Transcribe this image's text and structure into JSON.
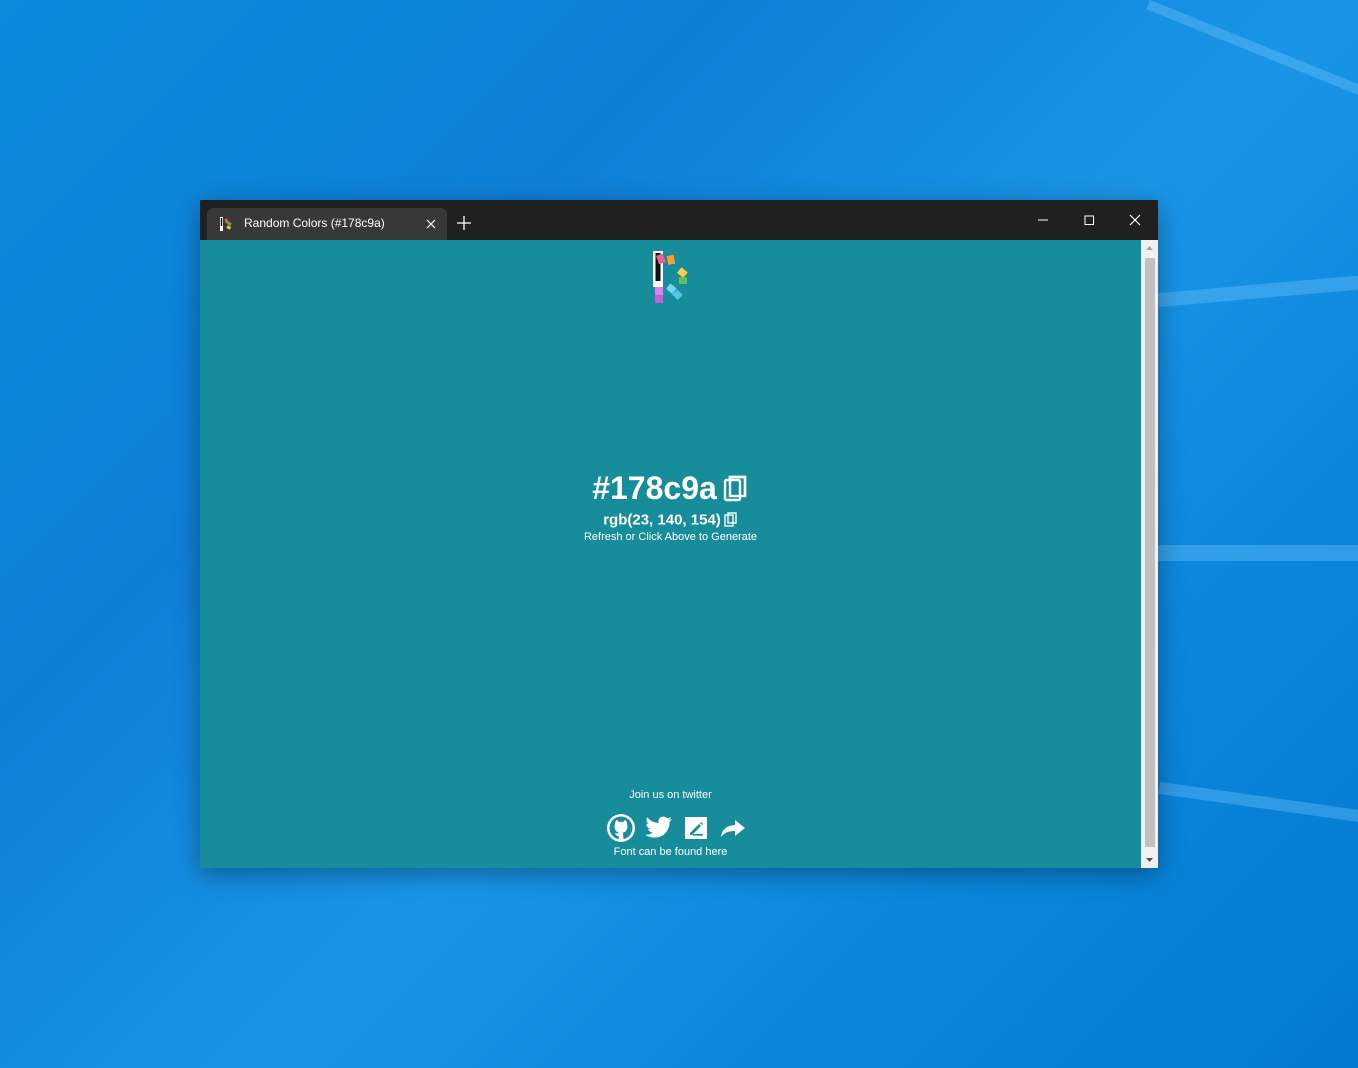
{
  "browser": {
    "tab": {
      "title": "Random Colors (#178c9a)"
    },
    "icons": {
      "favicon": "color-palette-logo-icon",
      "tab_close": "close-icon",
      "new_tab": "plus-icon",
      "minimize": "minimize-icon",
      "maximize": "maximize-icon",
      "close": "close-icon"
    }
  },
  "page": {
    "background_color": "#178c9a",
    "hex": "#178c9a",
    "rgb": "rgb(23, 140, 154)",
    "hint": "Refresh or Click Above to Generate",
    "twitter_cta": "Join us on twitter",
    "font_link": "Font can be found here",
    "social_icons": [
      "github-icon",
      "twitter-icon",
      "edit-icon",
      "share-icon"
    ]
  },
  "colors": {
    "titlebar": "#202020",
    "tab_active": "#383838",
    "text": "#ffffff",
    "scrollbar_track": "#f0f0f0",
    "scrollbar_thumb": "#c1c1c1"
  }
}
